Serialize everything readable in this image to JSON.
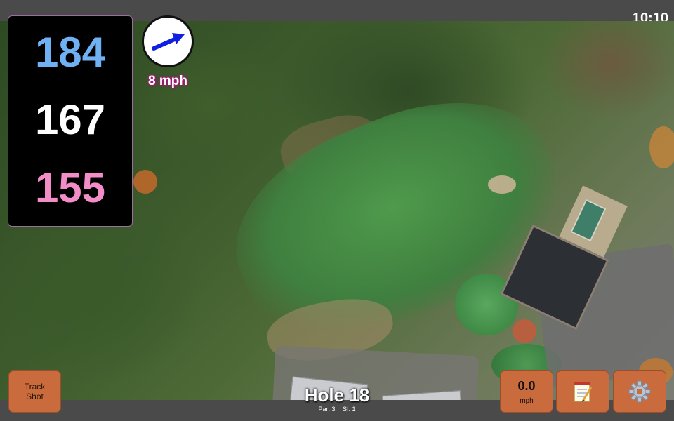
{
  "status": {
    "time": "10:10"
  },
  "distances": {
    "back": "184",
    "middle": "167",
    "front": "155"
  },
  "wind": {
    "speed": "8 mph",
    "direction_icon": "wind-arrow-icon"
  },
  "buttons": {
    "track_shot": {
      "line1": "Track",
      "line2": "Shot"
    },
    "speed": {
      "value": "0.0",
      "unit": "mph"
    },
    "notes_icon": "notepad-icon",
    "settings_icon": "gear-icon"
  },
  "hole": {
    "title": "Hole 18",
    "par": "Par: 3",
    "si": "SI: 1"
  },
  "colors": {
    "back": "#6fb1f2",
    "middle": "#ffffff",
    "front": "#f28dc8",
    "button": "#c96b3c"
  }
}
